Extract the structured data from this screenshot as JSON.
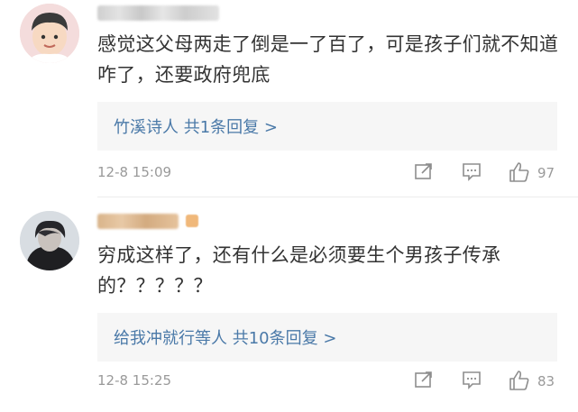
{
  "comments": [
    {
      "text": "感觉这父母两走了倒是一了百了，可是孩子们就不知道咋了，还要政府兜底",
      "replies_label": "竹溪诗人 共1条回复 >",
      "time": "12-8 15:09",
      "likes": "97",
      "avatar_icon": "cartoon-boy-avatar"
    },
    {
      "text": "穷成这样了，还有什么是必须要生个男孩子传承的？？？？？",
      "replies_label": "给我冲就行等人 共10条回复 >",
      "time": "12-8 15:25",
      "likes": "83",
      "avatar_icon": "dark-portrait-avatar"
    }
  ],
  "colors": {
    "link": "#4a79a8",
    "meta": "#9a9a9a",
    "text": "#333333",
    "reply_bg": "#f6f6f6"
  }
}
